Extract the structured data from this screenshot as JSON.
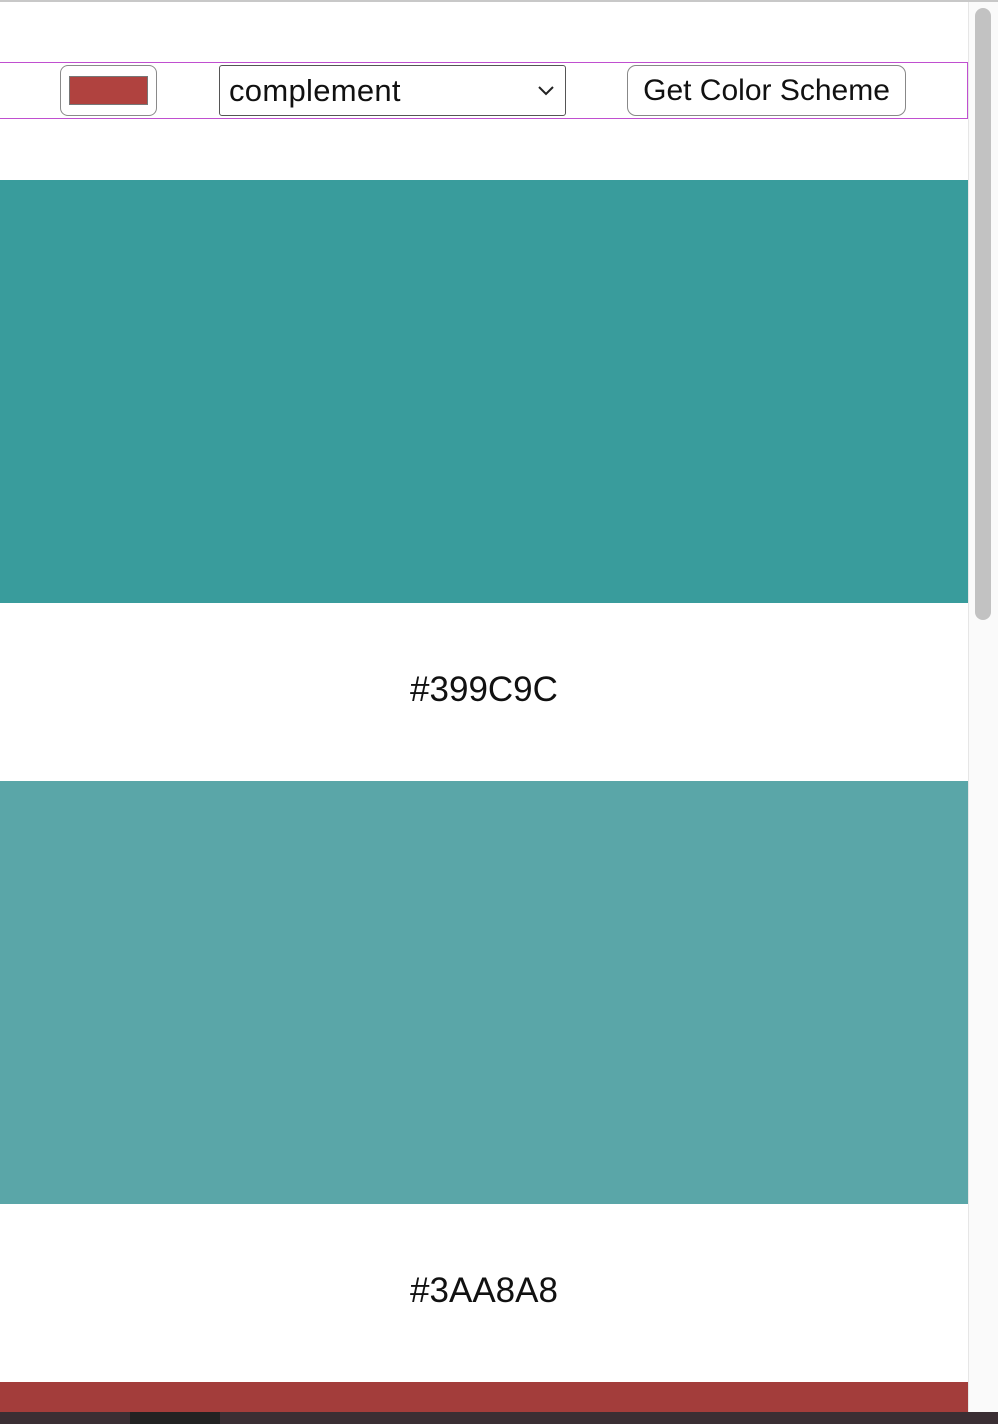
{
  "controls": {
    "seed_color": "#B0423F",
    "mode_value": "complement",
    "get_button_label": "Get Color Scheme"
  },
  "scheme": {
    "colors": [
      {
        "hex": "#399C9C",
        "label": "#399C9C"
      },
      {
        "hex": "#5AA6A8",
        "label": "#3AA8A8"
      },
      {
        "hex": "#A33D3B",
        "label": ""
      }
    ]
  },
  "theme": {
    "control_outline": "#C04FD0"
  }
}
